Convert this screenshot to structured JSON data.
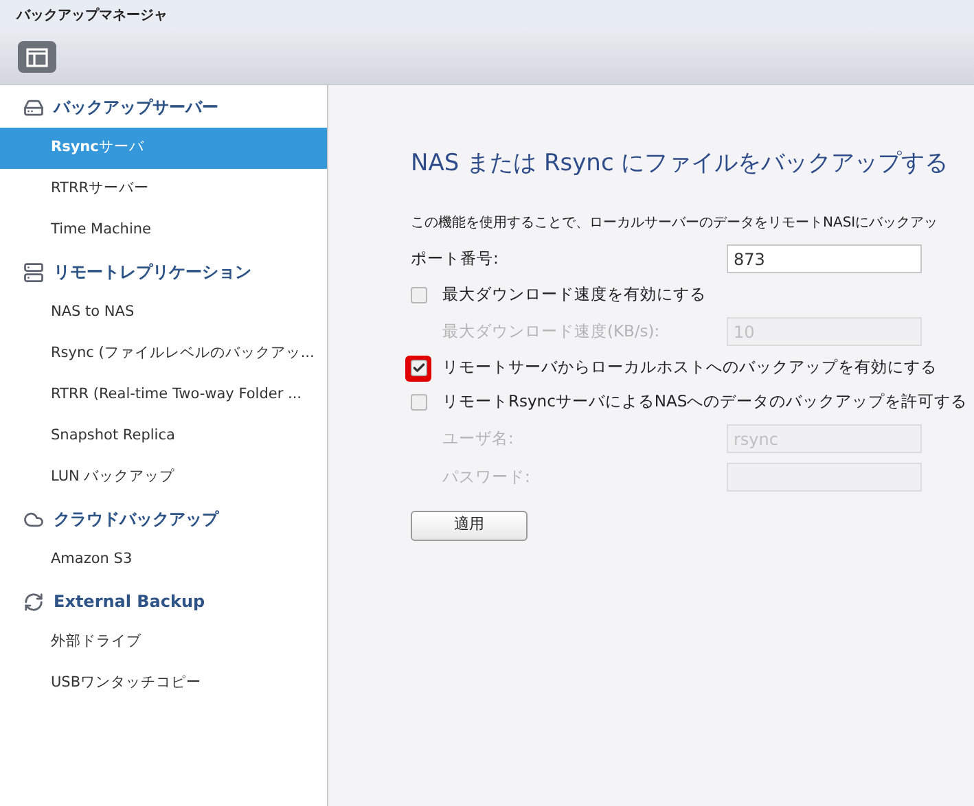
{
  "window": {
    "title": "バックアップマネージャ"
  },
  "sidebar": {
    "groups": [
      {
        "kind": "drive",
        "label": "バックアップサーバー",
        "items": [
          {
            "label": "**Rsync**サーバ",
            "selected": true
          },
          {
            "label": "RTRRサーバー",
            "selected": false
          },
          {
            "label": "Time Machine",
            "selected": false
          }
        ]
      },
      {
        "kind": "server",
        "label": "リモートレプリケーション",
        "items": [
          {
            "label": "NAS to NAS",
            "selected": false
          },
          {
            "label": "Rsync (ファイルレベルのバックアッ...",
            "selected": false
          },
          {
            "label": "RTRR (Real-time Two-way Folder ...",
            "selected": false
          },
          {
            "label": "Snapshot Replica",
            "selected": false
          },
          {
            "label": "LUN バックアップ",
            "selected": false
          }
        ]
      },
      {
        "kind": "cloud",
        "label": "クラウドバックアップ",
        "items": [
          {
            "label": "Amazon S3",
            "selected": false
          }
        ]
      },
      {
        "kind": "sync",
        "label": "External Backup",
        "items": [
          {
            "label": "外部ドライブ",
            "selected": false
          },
          {
            "label": "USBワンタッチコピー",
            "selected": false
          }
        ]
      }
    ]
  },
  "main": {
    "title": "NAS または Rsync にファイルをバックアップする",
    "description": "この機能を使用することで、ローカルサーバーのデータをリモートNASIにバックアッ",
    "rows": [
      {
        "kind": "field",
        "label": "ポート番号:",
        "value": "873",
        "disabled": false
      },
      {
        "kind": "checkbox",
        "label": "最大ダウンロード速度を有効にする",
        "checked": false,
        "highlighted": false
      },
      {
        "kind": "subfield",
        "label": "最大ダウンロード速度(KB/s):",
        "value": "10",
        "disabled": true
      },
      {
        "kind": "checkbox",
        "label": "リモートサーバからローカルホストへのバックアップを有効にする",
        "checked": true,
        "highlighted": true
      },
      {
        "kind": "checkbox",
        "label": "リモートRsyncサーバによるNASへのデータのバックアップを許可する",
        "checked": false,
        "highlighted": false
      },
      {
        "kind": "subfield",
        "label": "ユーザ名:",
        "value": "rsync",
        "disabled": true
      },
      {
        "kind": "subfield",
        "label": "パスワード:",
        "disabled": true
      }
    ],
    "apply_button": "適用"
  }
}
